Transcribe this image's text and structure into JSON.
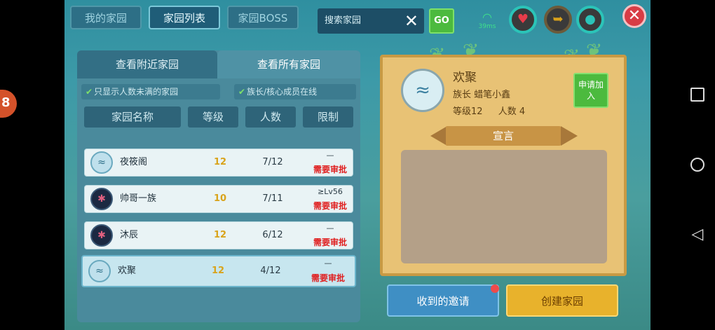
{
  "side_button_label": "8",
  "tabs": [
    {
      "label": "我的家园"
    },
    {
      "label": "家园列表"
    },
    {
      "label": "家园BOSS"
    }
  ],
  "search": {
    "placeholder": "搜索家园",
    "clear_symbol": "✕",
    "go_label": "GO"
  },
  "status": {
    "ping": "39ms",
    "heart_icon": "heart-icon",
    "energy_icon": "energy-icon",
    "water_icon": "water-drop-icon"
  },
  "close_symbol": "✕",
  "subtabs": {
    "nearby": "查看附近家园",
    "all": "查看所有家园"
  },
  "filters": {
    "not_full": "只显示人数未满的家园",
    "leader_online": "族长/核心成员在线"
  },
  "columns": {
    "name": "家园名称",
    "level": "等级",
    "count": "人数",
    "limit": "限制"
  },
  "rows": [
    {
      "name": "夜筱阁",
      "level": "12",
      "count": "7/12",
      "limit": "—",
      "approval": "需要审批",
      "avatar": "fish-icon"
    },
    {
      "name": "帅哥一族",
      "level": "10",
      "count": "7/11",
      "limit": "≥Lv56",
      "approval": "需要审批",
      "avatar": "octopus-icon"
    },
    {
      "name": "沐辰",
      "level": "12",
      "count": "6/12",
      "limit": "—",
      "approval": "需要审批",
      "avatar": "octopus-icon"
    },
    {
      "name": "欢聚",
      "level": "12",
      "count": "4/12",
      "limit": "—",
      "approval": "需要审批",
      "avatar": "fish-icon"
    }
  ],
  "detail": {
    "name": "欢聚",
    "leader_label": "族长",
    "leader_name": "蜡笔小鑫",
    "level_text": "等级12",
    "count_text": "人数 4",
    "apply_label": "申请加入",
    "manifesto_title": "宣言",
    "manifesto_text": ""
  },
  "buttons": {
    "invites": "收到的邀请",
    "create": "创建家园"
  }
}
